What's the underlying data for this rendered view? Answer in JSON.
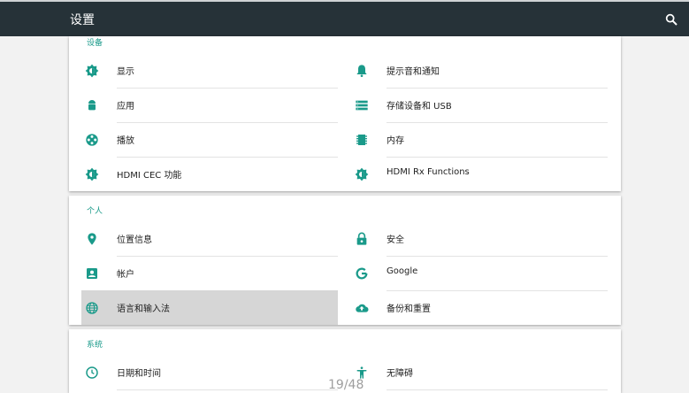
{
  "appbar": {
    "title": "设置",
    "search_icon": "search-icon"
  },
  "colors": {
    "accent": "#1a9a8a",
    "appbar": "#263238"
  },
  "sections": [
    {
      "title": "设备",
      "items": [
        {
          "label": "显示",
          "icon": "brightness-icon"
        },
        {
          "label": "提示音和通知",
          "icon": "bell-icon"
        },
        {
          "label": "应用",
          "icon": "android-icon"
        },
        {
          "label": "存储设备和 USB",
          "icon": "storage-icon"
        },
        {
          "label": "播放",
          "icon": "film-reel-icon"
        },
        {
          "label": "内存",
          "icon": "memory-chip-icon"
        },
        {
          "label": "HDMI CEC 功能",
          "icon": "brightness-icon"
        },
        {
          "label": "HDMI Rx Functions",
          "icon": "brightness-icon"
        }
      ]
    },
    {
      "title": "个人",
      "items": [
        {
          "label": "位置信息",
          "icon": "location-pin-icon"
        },
        {
          "label": "安全",
          "icon": "lock-icon"
        },
        {
          "label": "帐户",
          "icon": "account-box-icon"
        },
        {
          "label": "Google",
          "icon": "google-icon"
        },
        {
          "label": "语言和输入法",
          "icon": "globe-icon",
          "selected": true
        },
        {
          "label": "备份和重置",
          "icon": "cloud-upload-icon"
        }
      ]
    },
    {
      "title": "系统",
      "items": [
        {
          "label": "日期和时间",
          "icon": "clock-icon"
        },
        {
          "label": "无障碍",
          "icon": "accessibility-icon"
        }
      ]
    }
  ],
  "pager": {
    "text": "19/48"
  }
}
